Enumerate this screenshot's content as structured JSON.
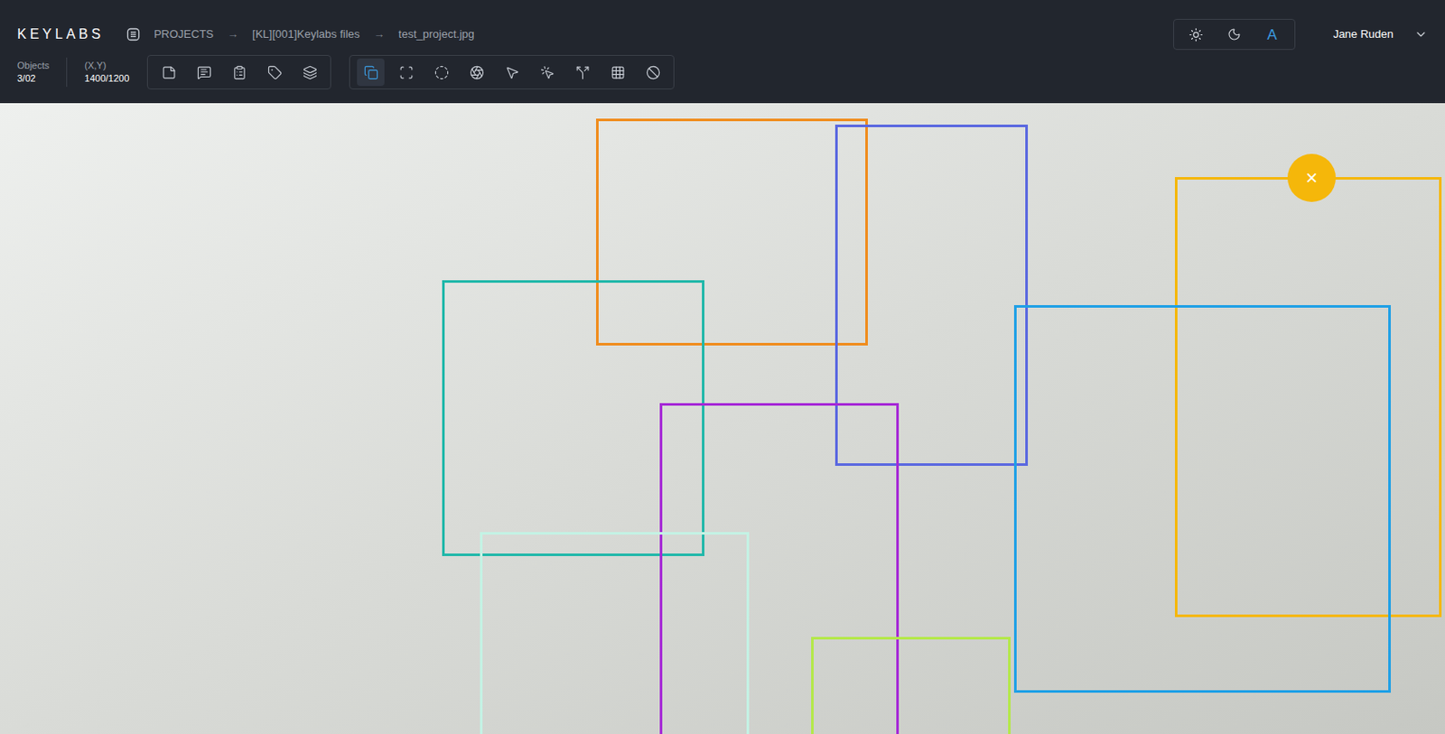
{
  "app": {
    "logo": "KEYLABS"
  },
  "breadcrumb": {
    "items": [
      "PROJECTS",
      "[KL][001]Keylabs files",
      "test_project.jpg"
    ],
    "separator": "→"
  },
  "theme_switcher": [
    {
      "kind": "sun",
      "label": "",
      "selected": false
    },
    {
      "kind": "moon",
      "label": "",
      "selected": false
    },
    {
      "kind": "text",
      "label": "A",
      "selected": true
    }
  ],
  "user": {
    "name": "Jane Ruden"
  },
  "stats": [
    {
      "label": "Objects",
      "value": "3/02"
    },
    {
      "label": "(X,Y)",
      "value": "1400/1200"
    }
  ],
  "toolbar_groups": [
    {
      "tools": [
        {
          "kind": "note",
          "selected": false
        },
        {
          "kind": "comment",
          "selected": false
        },
        {
          "kind": "list",
          "selected": false
        },
        {
          "kind": "tag",
          "selected": false
        },
        {
          "kind": "layers",
          "selected": false
        }
      ]
    },
    {
      "tools": [
        {
          "kind": "box",
          "selected": true
        },
        {
          "kind": "polygon",
          "selected": false
        },
        {
          "kind": "circle",
          "selected": false
        },
        {
          "kind": "keypoint",
          "selected": false
        },
        {
          "kind": "cursor",
          "selected": false
        },
        {
          "kind": "click",
          "selected": false
        },
        {
          "kind": "split",
          "selected": false
        },
        {
          "kind": "grid",
          "selected": false
        },
        {
          "kind": "ban",
          "selected": false
        }
      ]
    }
  ],
  "annotations": [
    {
      "color": "#f08c1c",
      "selected": false
    },
    {
      "color": "#5a68e0",
      "selected": false
    },
    {
      "color": "#f5b70a",
      "selected": true
    },
    {
      "color": "#1fa0e6",
      "selected": false
    },
    {
      "color": "#22b8aa",
      "selected": false
    },
    {
      "color": "#a62ad6",
      "selected": false
    },
    {
      "color": "#c4f2e4",
      "selected": false
    },
    {
      "color": "#b4e84a",
      "selected": false
    }
  ],
  "delete_button": "×"
}
